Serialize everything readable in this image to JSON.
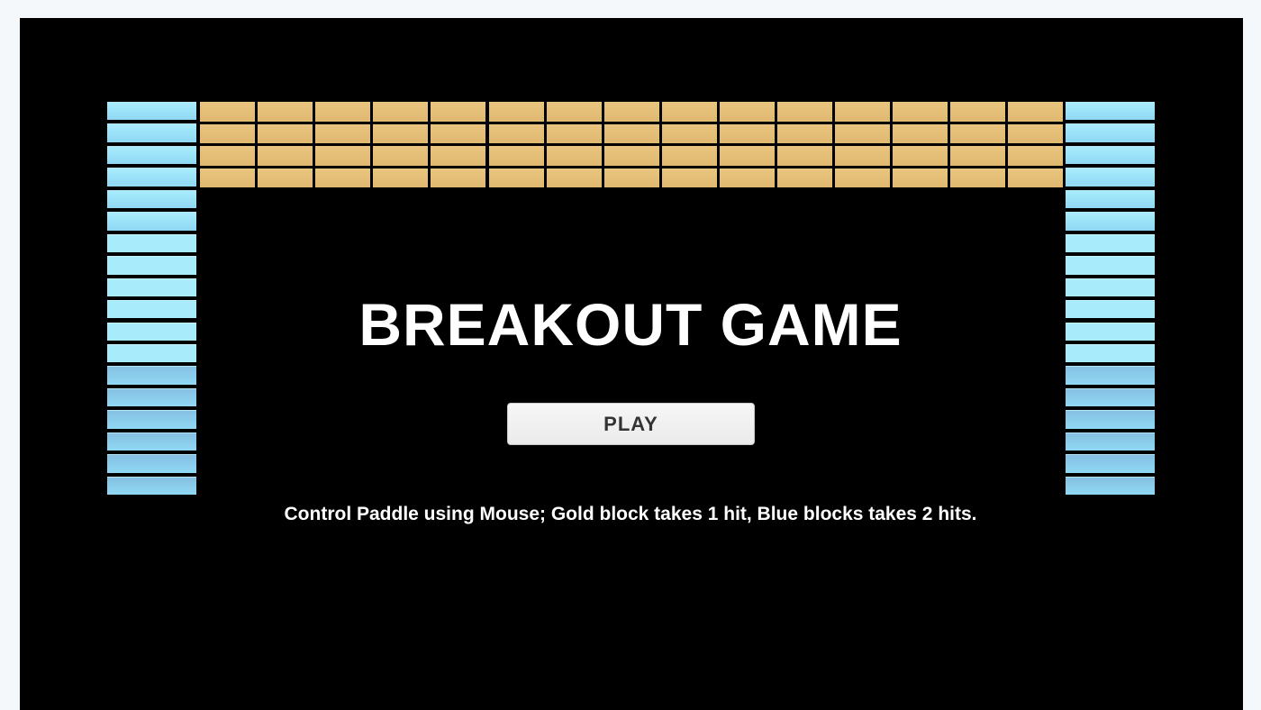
{
  "game": {
    "title": "BREAKOUT GAME",
    "play_label": "PLAY",
    "instructions": "Control Paddle using Mouse; Gold block takes 1 hit, Blue blocks takes 2 hits."
  },
  "colors": {
    "background": "#000000",
    "gold_block": "#e0b870",
    "blue_block_light": "#a8ecfc",
    "blue_block_mid": "#8fd8f4",
    "blue_block_dark": "#86c0e2",
    "text": "#ffffff"
  },
  "bricks": {
    "gold": {
      "rows": 4,
      "columns": 15,
      "hits": 1
    },
    "blue_left": {
      "rows": 18,
      "columns": 1,
      "hits": 2
    },
    "blue_right": {
      "rows": 18,
      "columns": 1,
      "hits": 2
    }
  }
}
